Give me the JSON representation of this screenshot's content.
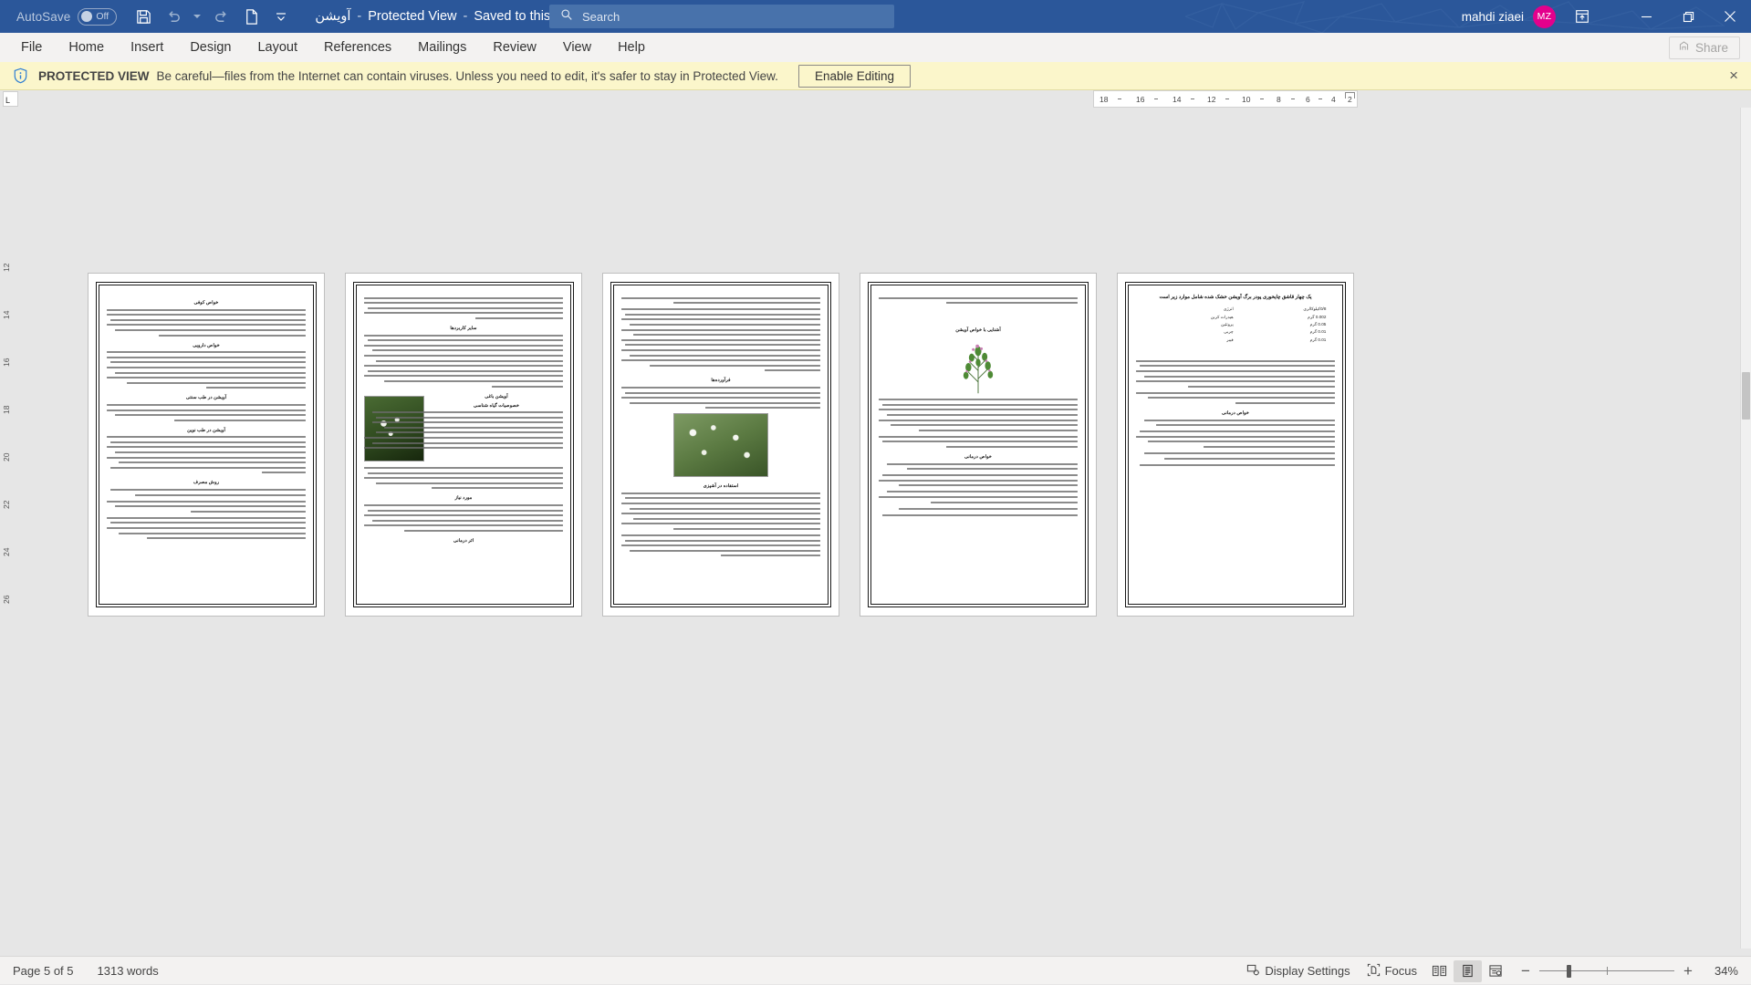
{
  "titlebar": {
    "autosave_label": "AutoSave",
    "autosave_state": "Off",
    "doc_name": "آویشن",
    "mode": "Protected View",
    "save_location": "Saved to this PC",
    "separator": "-",
    "quick_access": [
      {
        "name": "save-icon",
        "label": "Save"
      },
      {
        "name": "undo-icon",
        "label": "Undo"
      },
      {
        "name": "redo-icon",
        "label": "Redo"
      },
      {
        "name": "new-document-icon",
        "label": "New"
      },
      {
        "name": "customize-quick-access-toolbar-icon",
        "label": "Customize Quick Access Toolbar"
      }
    ],
    "account_name": "mahdi ziaei",
    "account_initials": "MZ",
    "ribbon_display_options": "Ribbon Display Options",
    "window_minimize": "Minimize",
    "window_restore": "Restore Down",
    "window_close": "Close",
    "accent_color": "#2b579a",
    "avatar_color": "#e3008c"
  },
  "search": {
    "placeholder": "Search",
    "value": "Search",
    "icon": "search-icon"
  },
  "ribbon_tabs": [
    {
      "label": "File"
    },
    {
      "label": "Home"
    },
    {
      "label": "Insert"
    },
    {
      "label": "Design"
    },
    {
      "label": "Layout"
    },
    {
      "label": "References"
    },
    {
      "label": "Mailings"
    },
    {
      "label": "Review"
    },
    {
      "label": "View"
    },
    {
      "label": "Help"
    }
  ],
  "share": {
    "label": "Share",
    "icon": "share-icon",
    "enabled": false
  },
  "protected_view": {
    "icon": "shield-info-icon",
    "title": "PROTECTED VIEW",
    "message": "Be careful—files from the Internet can contain viruses. Unless you need to edit, it's safer to stay in Protected View.",
    "button_label": "Enable Editing",
    "close_label": "×",
    "background_color": "#fbf6cb"
  },
  "ruler": {
    "corner_label": "L",
    "ticks": [
      "18",
      "16",
      "14",
      "12",
      "10",
      "8",
      "6",
      "4",
      "2"
    ],
    "vertical_ticks": [
      "12",
      "14",
      "16",
      "18",
      "20",
      "22",
      "24",
      "26"
    ]
  },
  "document": {
    "page_count": 5,
    "zoom": "34%",
    "pages": [
      {
        "index": 5,
        "name": "page-5",
        "sections": [
          {
            "type": "heading",
            "text": "خواص کوفی"
          },
          {
            "type": "paragraph"
          },
          {
            "type": "heading",
            "text": "خواص دارویی"
          },
          {
            "type": "paragraph"
          },
          {
            "type": "heading",
            "text": "آویشن در طب سنتی"
          },
          {
            "type": "paragraph"
          },
          {
            "type": "heading",
            "text": "آویشن در طب نوین"
          },
          {
            "type": "paragraph"
          },
          {
            "type": "heading",
            "text": "روش مصرف"
          },
          {
            "type": "paragraph"
          }
        ]
      },
      {
        "index": 4,
        "name": "page-4",
        "sections": [
          {
            "type": "paragraph"
          },
          {
            "type": "heading",
            "text": "سایر کاربردها"
          },
          {
            "type": "paragraph"
          },
          {
            "type": "image",
            "name": "thyme-flower-photo"
          },
          {
            "type": "heading",
            "text": "آویشن باغی"
          },
          {
            "type": "heading",
            "text": "خصوصیات گیاه شناسی"
          },
          {
            "type": "paragraph",
            "note": "(Lamiaceae)"
          },
          {
            "type": "paragraph",
            "note": "SDI 20"
          },
          {
            "type": "heading",
            "text": "مورد نیاز"
          },
          {
            "type": "paragraph"
          },
          {
            "type": "heading",
            "text": "اثر درمانی"
          }
        ]
      },
      {
        "index": 3,
        "name": "page-3",
        "sections": [
          {
            "type": "paragraph"
          },
          {
            "type": "heading",
            "text": "فرآورده‌ها"
          },
          {
            "type": "paragraph"
          },
          {
            "type": "image",
            "name": "thyme-plant-photo"
          },
          {
            "type": "heading",
            "text": "استفاده در آشپزی"
          },
          {
            "type": "paragraph"
          }
        ]
      },
      {
        "index": 2,
        "name": "page-2",
        "sections": [
          {
            "type": "paragraph"
          },
          {
            "type": "heading",
            "text": "آشنایی با خواص آویشن"
          },
          {
            "type": "image",
            "name": "thyme-sprig-illustration"
          },
          {
            "type": "paragraph"
          },
          {
            "type": "heading",
            "text": "خواص درمانی"
          },
          {
            "type": "paragraph"
          }
        ]
      },
      {
        "index": 1,
        "name": "page-1",
        "title": "یک چهار قاشق چایخوری پودر برگ آویشن خشک شده شامل موارد زیر است",
        "nutrition_rows": [
          {
            "label": "انرژی",
            "value": "0/8کیلوکالری"
          },
          {
            "label": "هیدرات کربن",
            "value": "0.002 گرم"
          },
          {
            "label": "پروتئین",
            "value": "0.05 گرم"
          },
          {
            "label": "چربی",
            "value": "0.01 گرم"
          },
          {
            "label": "فیبر",
            "value": "0.01 گرم"
          }
        ],
        "sections": [
          {
            "type": "paragraph"
          },
          {
            "type": "heading",
            "text": "خواص درمانی"
          },
          {
            "type": "paragraph"
          }
        ]
      }
    ]
  },
  "statusbar": {
    "page_indicator": "Page 5 of 5",
    "word_count": "1313 words",
    "display_settings": "Display Settings",
    "display_settings_icon": "display-settings-icon",
    "focus": "Focus",
    "focus_icon": "focus-icon",
    "view_read_mode": "Read Mode",
    "view_print_layout": "Print Layout",
    "view_web_layout": "Web Layout",
    "zoom_out": "−",
    "zoom_in": "+",
    "zoom_level": "34%"
  }
}
